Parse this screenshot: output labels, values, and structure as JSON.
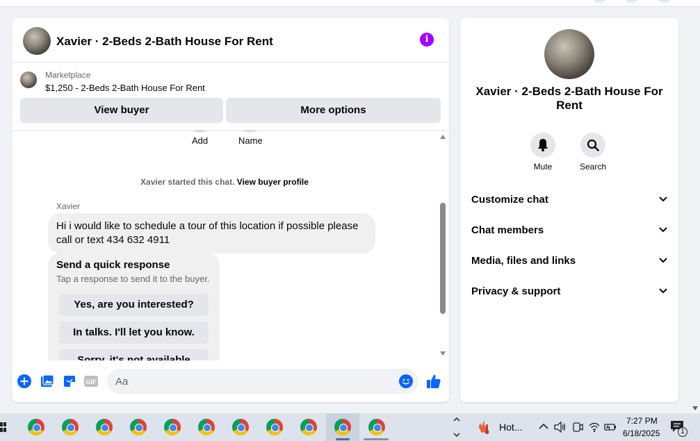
{
  "chat": {
    "title": "Xavier · 2-Beds 2-Bath House For Rent",
    "listing_label": "Marketplace",
    "listing_title": "$1,250 - 2-Beds 2-Bath House For Rent",
    "view_buyer": "View buyer",
    "more_options": "More options",
    "peek_add": "Add",
    "peek_name": "Name",
    "started_text": "Xavier started this chat.",
    "view_profile": "View buyer profile",
    "sender": "Xavier",
    "message": "Hi i would like to schedule a tour of this location if possible please call or text 434 632 4911",
    "quick_title": "Send a quick response",
    "quick_sub": "Tap a response to send it to the buyer.",
    "quick_responses": [
      "Yes, are you interested?",
      "In talks. I'll let you know.",
      "Sorry, it's not available"
    ],
    "composer_placeholder": "Aa"
  },
  "details": {
    "title": "Xavier · 2-Beds 2-Bath House For Rent",
    "mute": "Mute",
    "search": "Search",
    "sections": [
      "Customize chat",
      "Chat members",
      "Media, files and links",
      "Privacy & support"
    ]
  },
  "taskbar": {
    "weather": "Hot...",
    "time": "7:27 PM",
    "date": "6/18/2025",
    "notifications": "1"
  },
  "colors": {
    "messenger_blue": "#0866ff",
    "info_purple": "#a200ff"
  }
}
